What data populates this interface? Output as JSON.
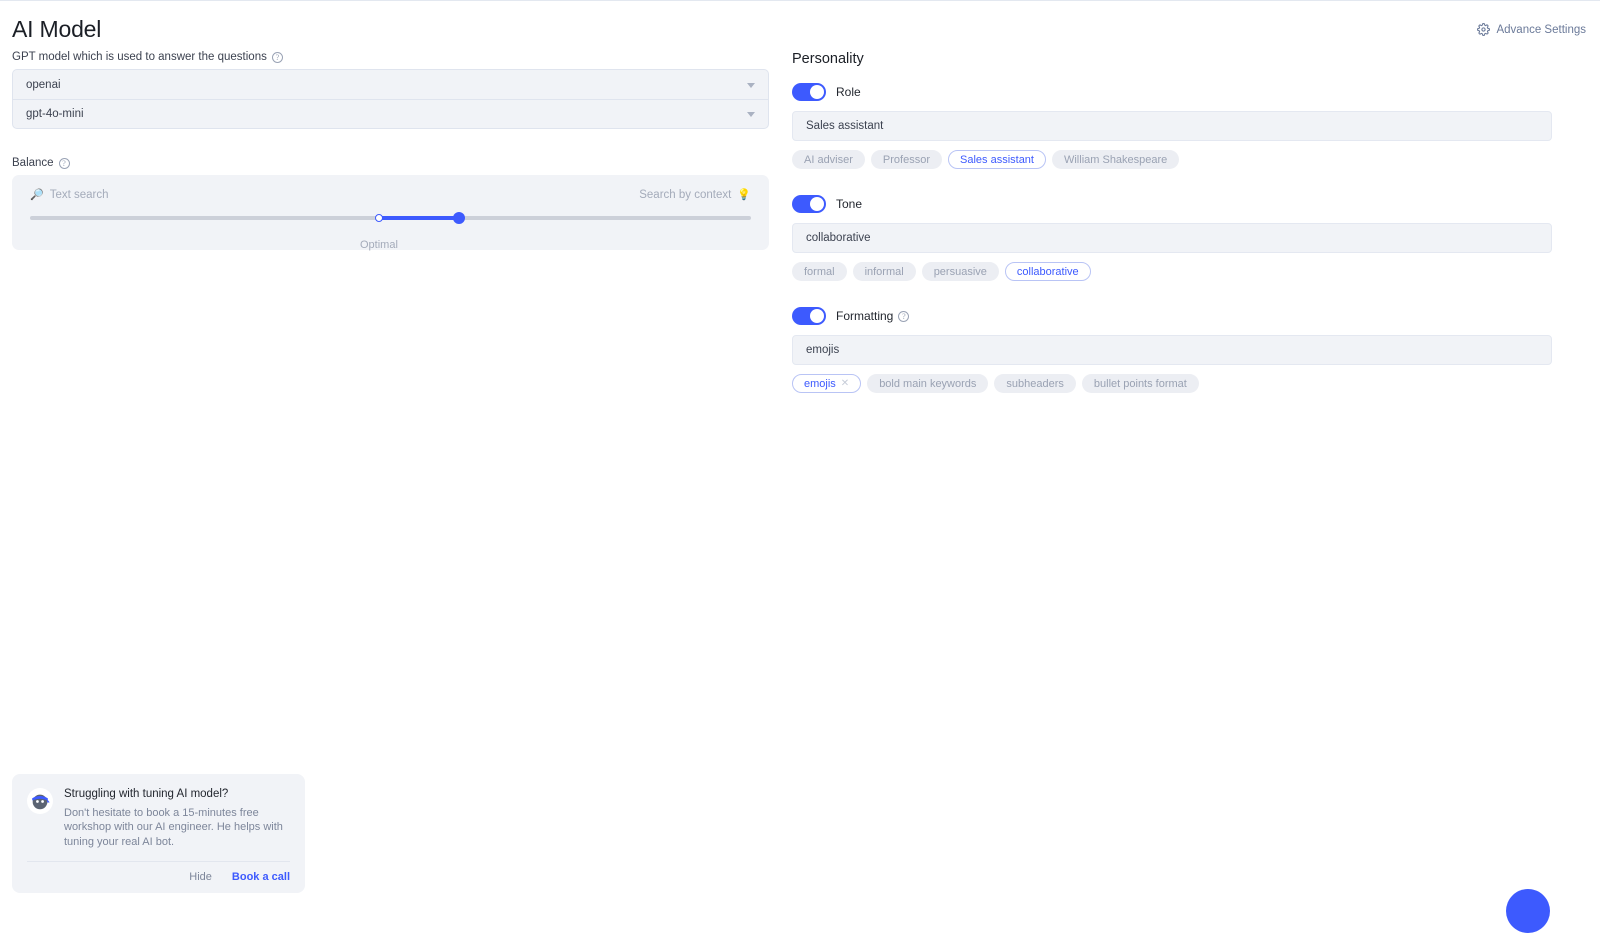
{
  "header": {
    "title": "AI Model",
    "advance_settings_label": "Advance Settings",
    "gear_icon": "gear-icon"
  },
  "model": {
    "label": "GPT model which is used to answer the questions",
    "help_icon": "?",
    "provider_value": "openai",
    "model_value": "gpt-4o-mini",
    "caret_icon": "chevron-down-icon"
  },
  "balance": {
    "label": "Balance",
    "help_icon": "?",
    "left_label": "Text search",
    "left_emoji": "🔎",
    "right_label": "Search by context",
    "right_emoji": "💡",
    "caption": "Optimal",
    "optimal_percent": 48.4,
    "value_percent": 59.5
  },
  "personality": {
    "title": "Personality",
    "groups": [
      {
        "label": "Role",
        "toggle_on": true,
        "has_help": false,
        "value": "Sales assistant",
        "chips": [
          {
            "label": "AI adviser",
            "selected": false,
            "closable": false
          },
          {
            "label": "Professor",
            "selected": false,
            "closable": false
          },
          {
            "label": "Sales assistant",
            "selected": true,
            "closable": false
          },
          {
            "label": "William Shakespeare",
            "selected": false,
            "closable": false
          }
        ]
      },
      {
        "label": "Tone",
        "toggle_on": true,
        "has_help": false,
        "value": "collaborative",
        "chips": [
          {
            "label": "formal",
            "selected": false,
            "closable": false
          },
          {
            "label": "informal",
            "selected": false,
            "closable": false
          },
          {
            "label": "persuasive",
            "selected": false,
            "closable": false
          },
          {
            "label": "collaborative",
            "selected": true,
            "closable": false
          }
        ]
      },
      {
        "label": "Formatting",
        "toggle_on": true,
        "has_help": true,
        "help_icon": "?",
        "value": "emojis",
        "chips": [
          {
            "label": "emojis",
            "selected": true,
            "closable": true,
            "close_icon": "✕"
          },
          {
            "label": "bold main keywords",
            "selected": false,
            "closable": false
          },
          {
            "label": "subheaders",
            "selected": false,
            "closable": false
          },
          {
            "label": "bullet points format",
            "selected": false,
            "closable": false
          }
        ]
      }
    ]
  },
  "promo": {
    "avatar_icon": "ninja-avatar",
    "avatar_emoji": "🥷",
    "heading": "Struggling with tuning AI model?",
    "body": "Don't hesitate to book a 15-minutes free workshop with our AI engineer. He helps with tuning your real AI bot.",
    "hide_label": "Hide",
    "book_label": "Book a call"
  },
  "chat_fab": {
    "icon": "chat-bubble-icon"
  },
  "colors": {
    "accent": "#3d5afe",
    "panel": "#f1f3f7",
    "text": "#23272f",
    "muted": "#9aa2b3"
  }
}
